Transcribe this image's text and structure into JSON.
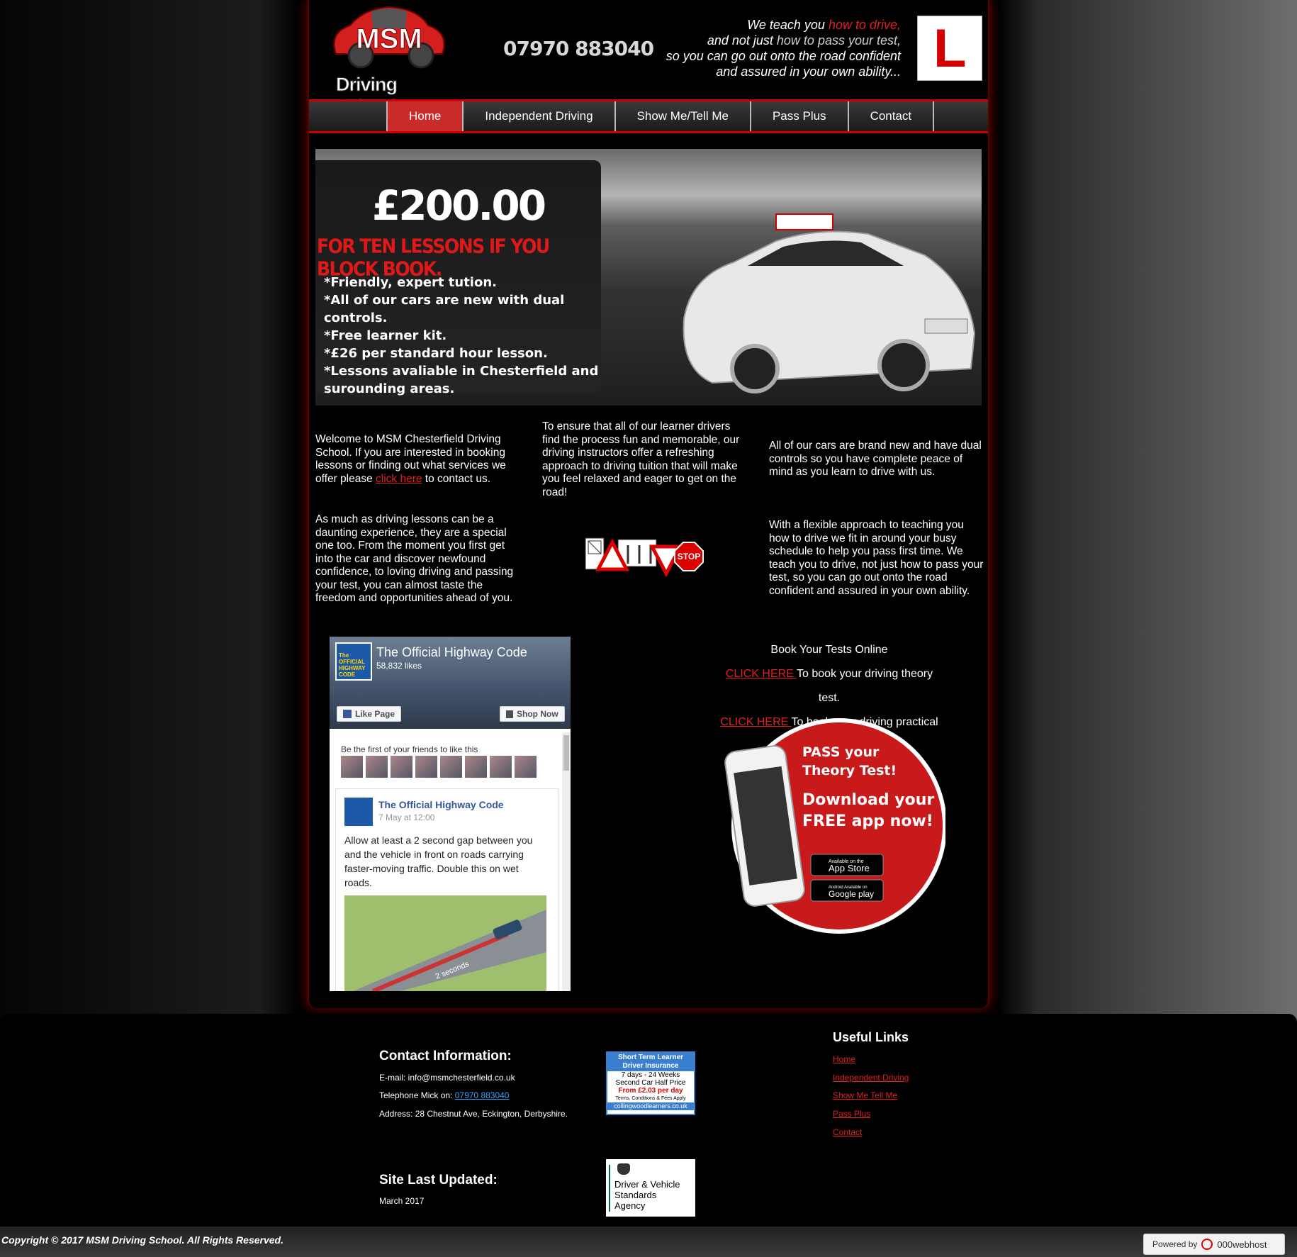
{
  "header": {
    "logo_text": "Driving School",
    "logo_letters": "MSM",
    "phone": "07970 883040",
    "tagline_1a": "We teach you",
    "tagline_1b": "how to drive,",
    "tagline_2a": "and not just",
    "tagline_2b": "how to pass your test,",
    "tagline_3": "so you can go out onto the road confident",
    "tagline_4": "and assured in your own ability...",
    "l_plate": "L"
  },
  "nav": {
    "items": [
      {
        "label": "Home",
        "active": true
      },
      {
        "label": "Independent Driving",
        "active": false
      },
      {
        "label": "Show Me/Tell Me",
        "active": false
      },
      {
        "label": "Pass Plus",
        "active": false
      },
      {
        "label": "Contact",
        "active": false
      }
    ]
  },
  "banner": {
    "price": "£200.00",
    "offer": "FOR TEN LESSONS IF YOU BLOCK BOOK.",
    "bullets": [
      "*Friendly, expert tution.",
      "*All of our cars are new with dual controls.",
      "*Free learner kit.",
      "*£26 per standard hour lesson.",
      "*Lessons avaliable in Chesterfield and",
      "surounding areas."
    ]
  },
  "content": {
    "col1_p1_before": "Welcome to MSM Chesterfield Driving School. If you are interested in booking lessons or finding out what services we offer please ",
    "col1_p1_link": "click here",
    "col1_p1_after": " to contact us.",
    "col1_p2": "As much as driving lessons can be a daunting experience, they are a special one too. From the moment you first get into the car and discover newfound confidence, to loving driving and passing your test, you can almost taste the freedom and opportunities ahead of you.",
    "col2_p1": "To ensure that all of our learner drivers find the process fun and memorable, our driving instructors offer a refreshing approach to driving tuition that will make you feel relaxed and eager to get on the road!",
    "col3_p1": "All of our cars are brand new and have dual controls so you have complete peace of mind as you learn to drive with us.",
    "col3_p2": "With a flexible approach to teaching you how to drive we fit in around your busy schedule to help you pass first time. We teach you to drive, not just how to pass your test, so you can go out onto the road confident and assured in your own ability.",
    "stop_sign": "STOP"
  },
  "facebook": {
    "page_name": "The Official Highway Code",
    "likes": "58,832 likes",
    "logo_text": "The OFFICIAL HIGHWAY CODE",
    "like_button": "Like Page",
    "shop_button": "Shop Now",
    "friends_text": "Be the first of your friends to like this",
    "post_name": "The Official Highway Code",
    "post_date": "7 May at 12:00",
    "post_text": "Allow at least a 2 second gap between you and the vehicle in front on roads carrying faster-moving traffic. Double this on wet roads.",
    "image_label": "2 seconds"
  },
  "booking": {
    "title": "Book Your Tests Online",
    "link1": "CLICK HERE ",
    "text1": "To book your driving theory test.",
    "link2": "CLICK HERE ",
    "text2": "To book your driving practical test."
  },
  "app_promo": {
    "line1": "PASS your",
    "line2": "Theory Test!",
    "line3": "Download your",
    "line4": "FREE app now!",
    "appstore_small": "Available on the",
    "appstore": "App Store",
    "googleplay_small": "Android Available on",
    "googleplay": "Google play"
  },
  "footer": {
    "contact_title": "Contact Information:",
    "email": "E-mail: info@msmchesterfield.co.uk",
    "phone_label": "Telephone Mick on: ",
    "phone_link": "07970 883040",
    "address": "Address: 28 Chestnut Ave, Eckington, Derbyshire.",
    "updated_title": "Site Last Updated:",
    "updated_date": "March 2017",
    "useful_title": "Useful Links",
    "links": [
      "Home",
      "Independent Driving",
      "Show Me Tell Me",
      "Pass Plus",
      "Contact"
    ],
    "insurance": {
      "line1": "Short Term Learner",
      "line2": "Driver Insurance",
      "line3": "7 days - 24 Weeks",
      "line4": "Second Car Half Price",
      "line5": "From £2.03 per day",
      "line6": "Terms, Conditions & Fees Apply",
      "line7": "collingwoodlearners.co.uk"
    },
    "dvsa": {
      "line1": "Driver & Vehicle",
      "line2": "Standards",
      "line3": "Agency"
    },
    "copyright": "Copyright © 2017 MSM Driving School. All Rights Reserved.",
    "powered_by": "Powered by",
    "host": "000webhost"
  }
}
